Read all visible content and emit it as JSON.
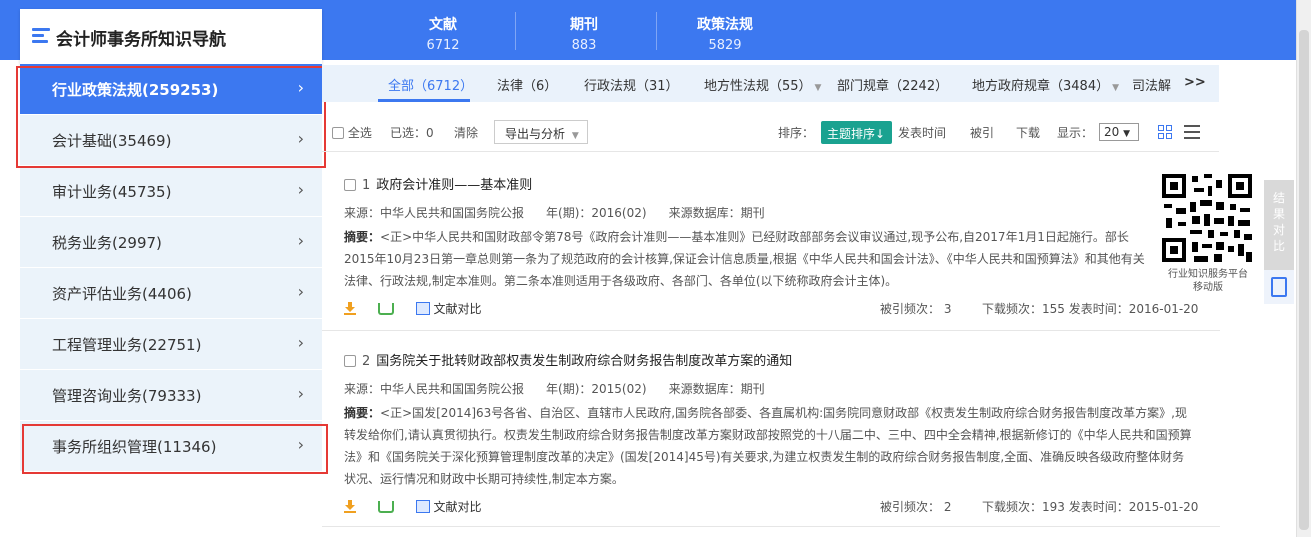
{
  "nav": {
    "title": "会计师事务所知识导航"
  },
  "stats": [
    {
      "label": "文献",
      "value": "6712"
    },
    {
      "label": "期刊",
      "value": "883"
    },
    {
      "label": "政策法规",
      "value": "5829"
    }
  ],
  "sidebar": {
    "items": [
      {
        "label": "行业政策法规(259253)"
      },
      {
        "label": "会计基础(35469)"
      },
      {
        "label": "审计业务(45735)"
      },
      {
        "label": "税务业务(2997)"
      },
      {
        "label": "资产评估业务(4406)"
      },
      {
        "label": "工程管理业务(22751)"
      },
      {
        "label": "管理咨询业务(79333)"
      },
      {
        "label": "事务所组织管理(11346)"
      }
    ],
    "chevron": "›"
  },
  "tabs": [
    {
      "label": "全部（6712）"
    },
    {
      "label": "法律（6）"
    },
    {
      "label": "行政法规（31）"
    },
    {
      "label": "地方性法规（55）"
    },
    {
      "label": "部门规章（2242）"
    },
    {
      "label": "地方政府规章（3484）"
    },
    {
      "label": "司法解"
    }
  ],
  "tab_more": ">>",
  "toolbar": {
    "select_all": "全选",
    "selected": "已选：0",
    "clear": "清除",
    "export": "导出与分析",
    "sort_label": "排序：",
    "sort_active": "主题排序↓",
    "sort_date": "发表时间",
    "sort_cited": "被引",
    "sort_download": "下载",
    "show_label": "显示：",
    "page_size": "20"
  },
  "results": [
    {
      "index": "1",
      "title": "政府会计准则——基本准则",
      "source": "来源：中华人民共和国国务院公报",
      "year": "年(期)：2016(02)",
      "db": "来源数据库：期刊",
      "abstract_label": "摘要：",
      "abstract": "<正>中华人民共和国财政部令第78号《政府会计准则——基本准则》已经财政部部务会议审议通过,现予公布,自2017年1月1日起施行。部长 2015年10月23日第一章总则第一条为了规范政府的会计核算,保证会计信息质量,根据《中华人民共和国会计法》、《中华人民共和国预算法》和其他有关法律、行政法规,制定本准则。第二条本准则适用于各级政府、各部门、各单位(以下统称政府会计主体)。",
      "compare": "文献对比",
      "cited": "被引频次： 3",
      "downloads": "下载频次：155",
      "date": "发表时间：2016-01-20"
    },
    {
      "index": "2",
      "title": "国务院关于批转财政部权责发生制政府综合财务报告制度改革方案的通知",
      "source": "来源：中华人民共和国国务院公报",
      "year": "年(期)：2015(02)",
      "db": "来源数据库：期刊",
      "abstract_label": "摘要：",
      "abstract": "<正>国发[2014]63号各省、自治区、直辖市人民政府,国务院各部委、各直属机构:国务院同意财政部《权责发生制政府综合财务报告制度改革方案》,现转发给你们,请认真贯彻执行。权责发生制政府综合财务报告制度改革方案财政部按照党的十八届二中、三中、四中全会精神,根据新修订的《中华人民共和国预算法》和《国务院关于深化预算管理制度改革的决定》(国发[2014]45号)有关要求,为建立权责发生制的政府综合财务报告制度,全面、准确反映各级政府整体财务状况、运行情况和财政中长期可持续性,制定本方案。",
      "compare": "文献对比",
      "cited": "被引频次： 2",
      "downloads": "下载频次：193",
      "date": "发表时间：2015-01-20"
    }
  ],
  "qr_caption": {
    "line1": "行业知识服务平台",
    "line2": "移动版"
  },
  "float_bar": {
    "label": "结果对比"
  },
  "colors": {
    "primary": "#3c78f0",
    "sidebar_bg": "#ebf3fa",
    "sort_green": "#1aa290",
    "highlight_red": "#e53935"
  }
}
